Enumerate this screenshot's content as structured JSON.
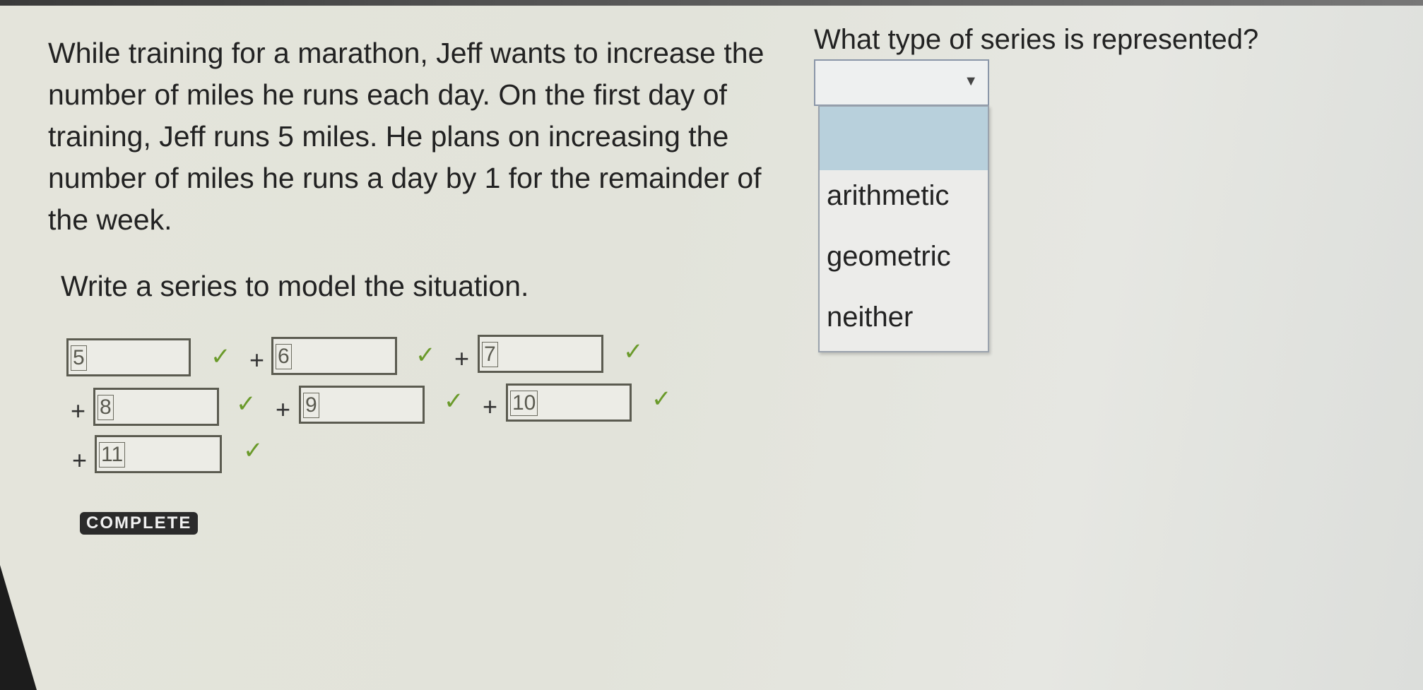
{
  "problem": {
    "prompt": "While training for a marathon, Jeff wants to increase the number of miles he runs each day. On the first day of training, Jeff runs 5 miles. He plans on increasing the number of miles he runs a day by 1 for the remainder of the week.",
    "instruction": "Write a series to model the situation.",
    "answers": [
      "5",
      "6",
      "7",
      "8",
      "9",
      "10",
      "11"
    ],
    "plus_sign": "+",
    "check_mark": "✓",
    "complete_badge": "COMPLETE"
  },
  "question": {
    "text": "What type of series is represented?",
    "select_value": "",
    "options": [
      "",
      "arithmetic",
      "geometric",
      "neither"
    ]
  },
  "colors": {
    "check": "#6a9a2a",
    "highlight": "#b8d0dc",
    "badge": "#2b2b2b"
  }
}
